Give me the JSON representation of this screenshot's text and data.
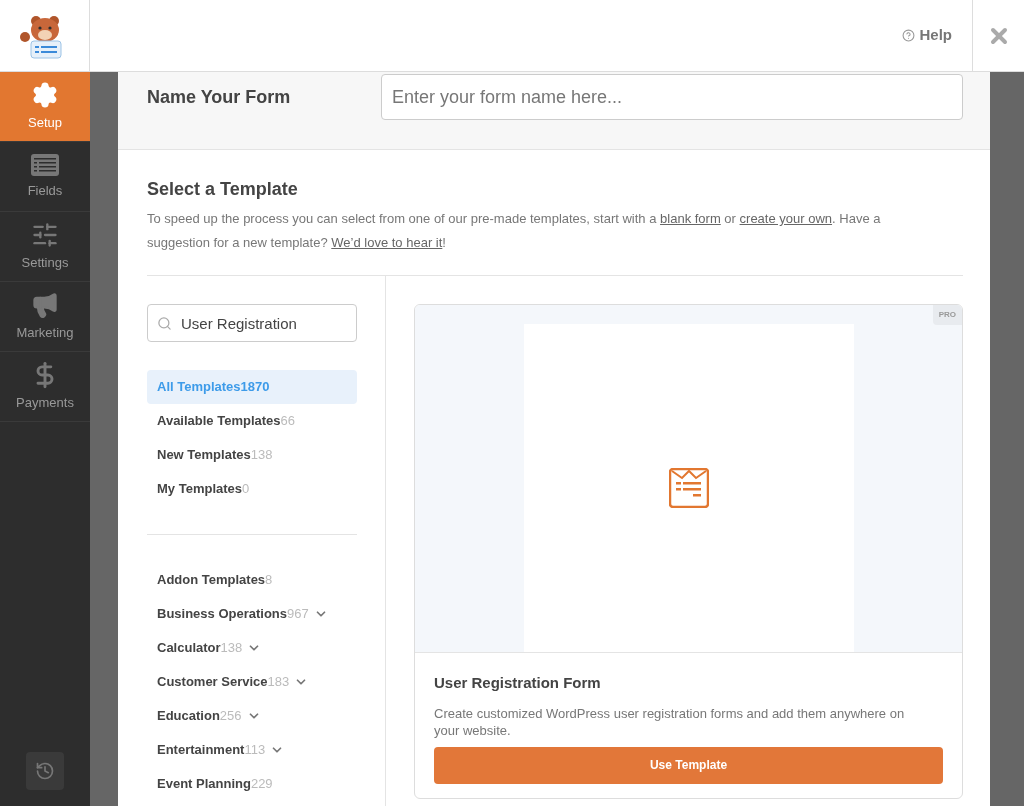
{
  "header": {
    "help": "Help"
  },
  "nav": [
    {
      "label": "Setup",
      "kind": "gear",
      "selected": true
    },
    {
      "label": "Fields",
      "kind": "list",
      "selected": false
    },
    {
      "label": "Settings",
      "kind": "sliders",
      "selected": false
    },
    {
      "label": "Marketing",
      "kind": "megaphone",
      "selected": false
    },
    {
      "label": "Payments",
      "kind": "dollar",
      "selected": false
    }
  ],
  "name_form": {
    "label": "Name Your Form",
    "placeholder": "Enter your form name here..."
  },
  "template_section": {
    "title": "Select a Template",
    "description": [
      {
        "kind": "text",
        "text": "To speed up the process you can select from one of our pre-made templates, start with a "
      },
      {
        "kind": "link",
        "text": "blank form"
      },
      {
        "kind": "text",
        "text": " or "
      },
      {
        "kind": "link",
        "text": "create your own"
      },
      {
        "kind": "text",
        "text": ". Have a suggestion for a new template? "
      },
      {
        "kind": "link",
        "text": "We’d love to hear it"
      },
      {
        "kind": "text",
        "text": "!"
      }
    ]
  },
  "search": {
    "value": "User Registration"
  },
  "filters": [
    {
      "label": "All Templates",
      "count": "1870",
      "selected": true
    },
    {
      "label": "Available Templates",
      "count": "66",
      "selected": false
    },
    {
      "label": "New Templates",
      "count": "138",
      "selected": false
    },
    {
      "label": "My Templates",
      "count": "0",
      "selected": false
    }
  ],
  "categories": [
    {
      "label": "Addon Templates",
      "count": "8",
      "expandable": false
    },
    {
      "label": "Business Operations",
      "count": "967",
      "expandable": true
    },
    {
      "label": "Calculator",
      "count": "138",
      "expandable": true
    },
    {
      "label": "Customer Service",
      "count": "183",
      "expandable": true
    },
    {
      "label": "Education",
      "count": "256",
      "expandable": true
    },
    {
      "label": "Entertainment",
      "count": "113",
      "expandable": true
    },
    {
      "label": "Event Planning",
      "count": "229",
      "expandable": false
    }
  ],
  "template_card": {
    "badge": "PRO",
    "title": "User Registration Form",
    "description": "Create customized WordPress user registration forms and add them anywhere on your website.",
    "button": "Use Template"
  }
}
